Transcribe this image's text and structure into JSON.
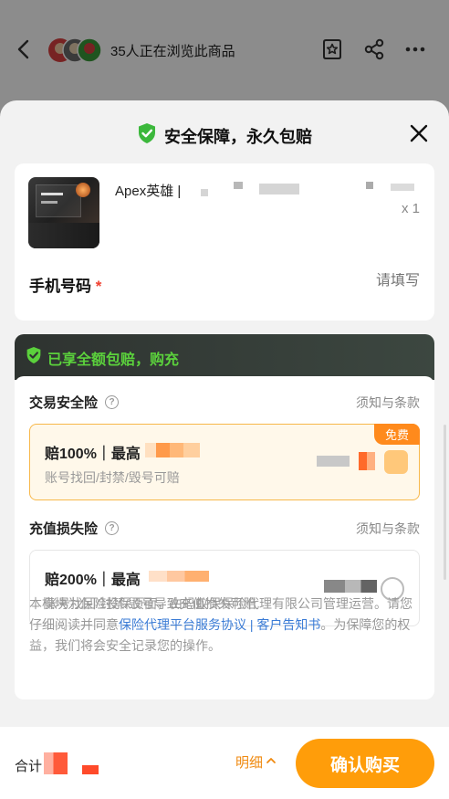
{
  "header": {
    "viewers_text": "35人正在浏览此商品",
    "icons": [
      "back-arrow-icon",
      "favorite-star-icon",
      "share-icon",
      "more-icon"
    ]
  },
  "sheet": {
    "title": "安全保障，永久包赔",
    "close_icon": "close-icon"
  },
  "product": {
    "name": "Apex英雄 |",
    "quantity": "x 1"
  },
  "phone": {
    "label": "手机号码",
    "required_mark": "*",
    "placeholder": "请填写"
  },
  "insurance": {
    "banner_text": "已享全额包赔，购充",
    "sections": [
      {
        "title": "交易安全险",
        "terms_link": "须知与条款",
        "option_main": "赔100%｜最高",
        "option_sub": "账号找回/封禁/毁号可赔",
        "tag": "免费",
        "selected": true
      },
      {
        "title": "充值损失险",
        "terms_link": "须知与条款",
        "option_main": "赔200%｜最高",
        "option_sub": "账号找回/封禁/毁号导致充值损失可赔",
        "selected": false
      }
    ],
    "disclaimer_pre": "本模块为保险投保页面，由蚂蚁保保险代理有限公司管理运营。请您仔细阅读并同意",
    "disclaimer_link": "保险代理平台服务协议 | 客户告知书",
    "disclaimer_post": "。为保障您的权益，我们将会安全记录您的操作。"
  },
  "footer": {
    "total_label": "合计",
    "detail_label": "明细",
    "confirm_label": "确认购买"
  },
  "colors": {
    "accent_orange": "#ff9d0a",
    "shield_green": "#5bd13c",
    "link_blue": "#3a7bd5"
  }
}
